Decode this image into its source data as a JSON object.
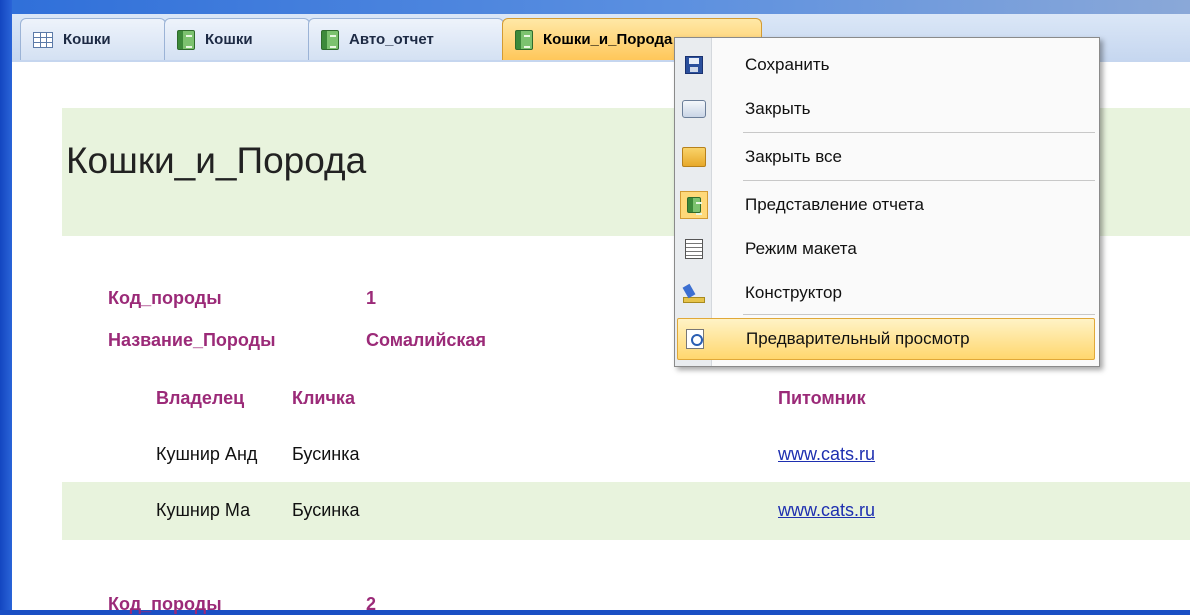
{
  "tabs": [
    {
      "label": "Кошки",
      "icon": "table-icon"
    },
    {
      "label": "Кошки",
      "icon": "report-icon"
    },
    {
      "label": "Авто_отчет",
      "icon": "report-icon"
    },
    {
      "label": "Кошки_и_Порода",
      "icon": "report-icon",
      "active": true
    }
  ],
  "report": {
    "title": "Кошки_и_Порода",
    "group1": {
      "code_label": "Код_породы",
      "code_value": "1",
      "name_label": "Название_Породы",
      "name_value": "Сомалийская"
    },
    "columns": {
      "owner": "Владелец",
      "nickname": "Кличка",
      "nursery": "Питомник"
    },
    "rows": [
      {
        "owner": "Кушнир Анд",
        "nickname": "Бусинка",
        "nursery": "www.cats.ru"
      },
      {
        "owner": "Кушнир Ма",
        "nickname": "Бусинка",
        "nursery": "www.cats.ru"
      }
    ],
    "group2": {
      "code_label": "Код_породы",
      "code_value": "2"
    }
  },
  "context_menu": {
    "items": [
      {
        "label": "Сохранить",
        "icon": "save-icon"
      },
      {
        "label": "Закрыть",
        "icon": "close-tab-icon"
      },
      {
        "label": "Закрыть все",
        "icon": "close-all-icon"
      },
      {
        "label": "Представление отчета",
        "icon": "report-view-icon"
      },
      {
        "label": "Режим макета",
        "icon": "layout-view-icon"
      },
      {
        "label": "Конструктор",
        "icon": "design-view-icon"
      },
      {
        "label": "Предварительный просмотр",
        "icon": "print-preview-icon",
        "highlighted": true
      }
    ]
  },
  "colors": {
    "frame_blue": "#1a4fc4",
    "label_magenta": "#9b2a78",
    "band_green": "#e8f3dd",
    "active_tab_orange": "#ffc75a",
    "link_blue": "#1e2fb0"
  }
}
